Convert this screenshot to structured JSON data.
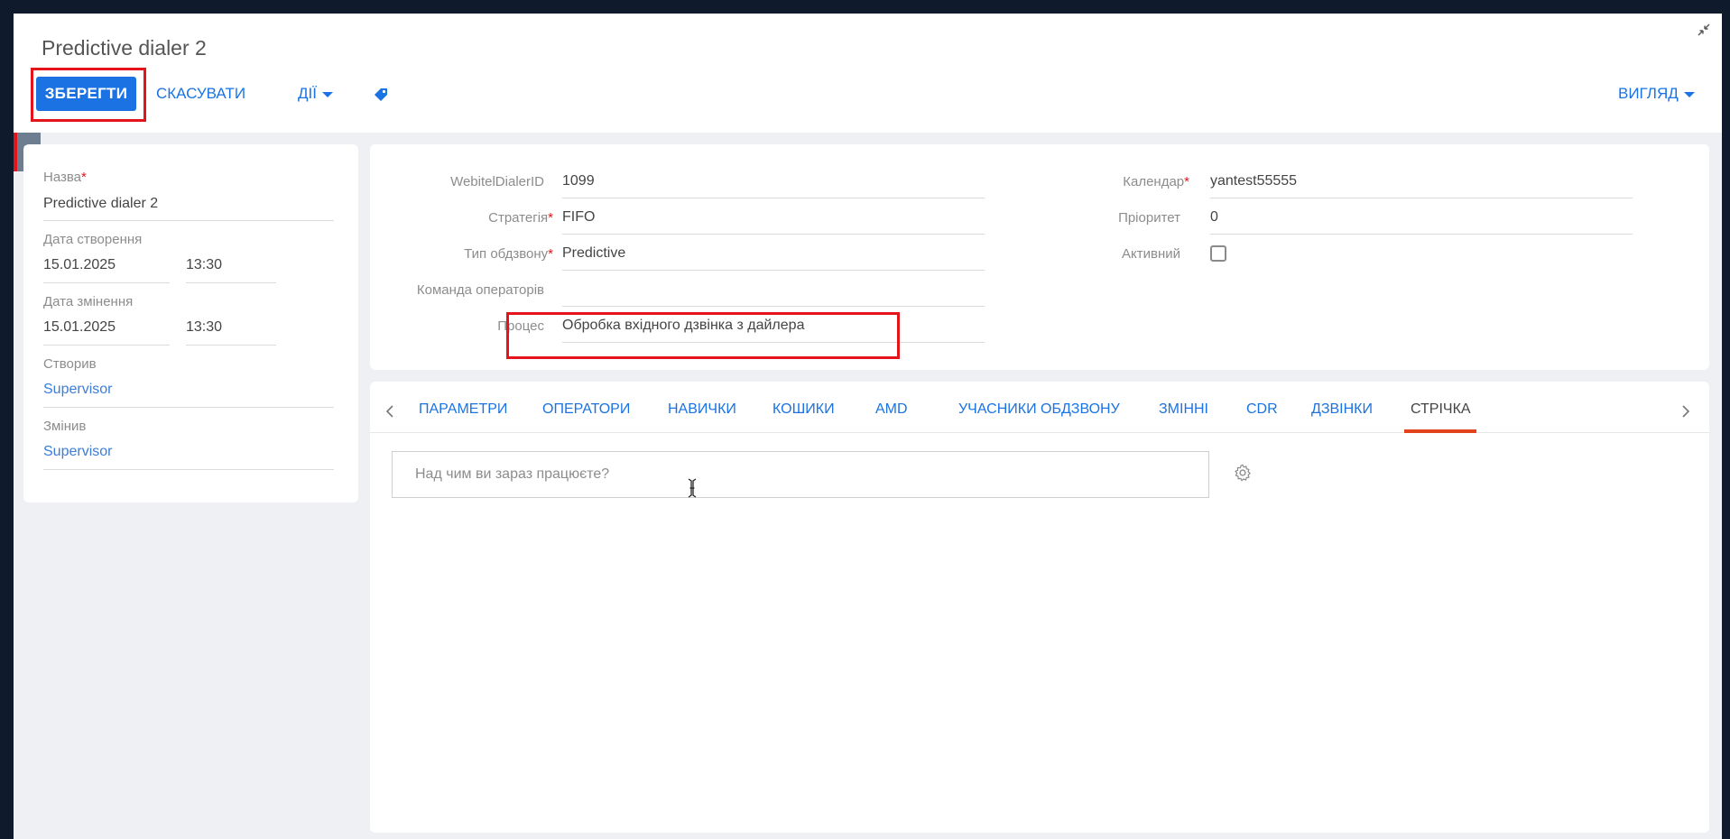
{
  "page": {
    "title": "Predictive dialer 2"
  },
  "toolbar": {
    "save_label": "ЗБЕРЕГТИ",
    "cancel_label": "СКАСУВАТИ",
    "actions_label": "ДІЇ",
    "view_label": "ВИГЛЯД"
  },
  "left": {
    "name_label": "Назва",
    "name_value": "Predictive dialer 2",
    "created_label": "Дата створення",
    "created_date": "15.01.2025",
    "created_time": "13:30",
    "modified_label": "Дата змінення",
    "modified_date": "15.01.2025",
    "modified_time": "13:30",
    "created_by_label": "Створив",
    "created_by_value": "Supervisor",
    "modified_by_label": "Змінив",
    "modified_by_value": "Supervisor"
  },
  "main": {
    "dialer_id_label": "WebitelDialerID",
    "dialer_id_value": "1099",
    "strategy_label": "Стратегія",
    "strategy_value": "FIFO",
    "type_label": "Тип обдзвону",
    "type_value": "Predictive",
    "team_label": "Команда операторів",
    "team_value": "",
    "process_label": "Процес",
    "process_value": "Обробка вхідного дзвінка з дайлера",
    "calendar_label": "Календар",
    "calendar_value": "yantest55555",
    "priority_label": "Пріоритет",
    "priority_value": "0",
    "active_label": "Активний"
  },
  "tabs": [
    {
      "label": "ПАРАМЕТРИ"
    },
    {
      "label": "ОПЕРАТОРИ"
    },
    {
      "label": "НАВИЧКИ"
    },
    {
      "label": "КОШИКИ"
    },
    {
      "label": "AMD"
    },
    {
      "label": "УЧАСНИКИ ОБДЗВОНУ"
    },
    {
      "label": "ЗМІННІ"
    },
    {
      "label": "CDR"
    },
    {
      "label": "ДЗВІНКИ"
    },
    {
      "label": "СТРІЧКА"
    }
  ],
  "feed": {
    "placeholder": "Над чим ви зараз працюєте?"
  },
  "colors": {
    "accent": "#1b73e3",
    "highlight": "#e3141c",
    "active_tab_underline": "#e3431c"
  }
}
